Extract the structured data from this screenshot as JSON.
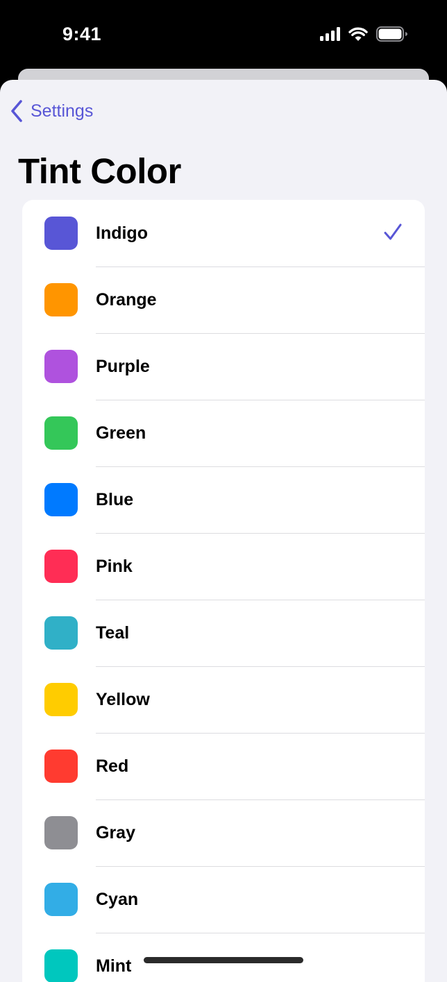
{
  "status_bar": {
    "time": "9:41"
  },
  "nav": {
    "back_label": "Settings"
  },
  "page": {
    "title": "Tint Color"
  },
  "colors": [
    {
      "label": "Indigo",
      "swatch": "#5856d6",
      "selected": true
    },
    {
      "label": "Orange",
      "swatch": "#ff9500",
      "selected": false
    },
    {
      "label": "Purple",
      "swatch": "#af52de",
      "selected": false
    },
    {
      "label": "Green",
      "swatch": "#34c759",
      "selected": false
    },
    {
      "label": "Blue",
      "swatch": "#007aff",
      "selected": false
    },
    {
      "label": "Pink",
      "swatch": "#ff2d55",
      "selected": false
    },
    {
      "label": "Teal",
      "swatch": "#30b0c7",
      "selected": false
    },
    {
      "label": "Yellow",
      "swatch": "#ffcc00",
      "selected": false
    },
    {
      "label": "Red",
      "swatch": "#ff3b30",
      "selected": false
    },
    {
      "label": "Gray",
      "swatch": "#8e8e93",
      "selected": false
    },
    {
      "label": "Cyan",
      "swatch": "#32ade6",
      "selected": false
    },
    {
      "label": "Mint",
      "swatch": "#00c7be",
      "selected": false
    }
  ],
  "theme": {
    "accent": "#5856d6",
    "background": "#f2f2f7"
  }
}
